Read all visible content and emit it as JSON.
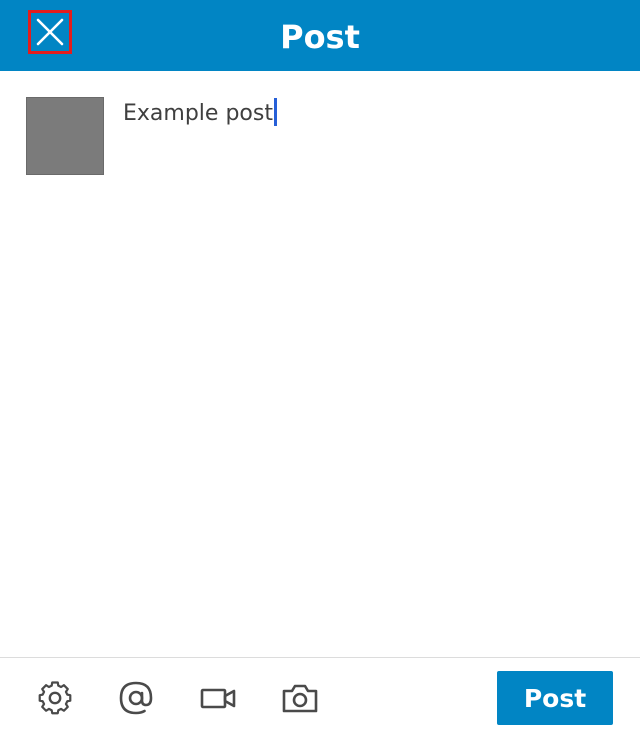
{
  "header": {
    "title": "Post",
    "close_icon": "close-icon"
  },
  "composer": {
    "text": "Example post"
  },
  "toolbar": {
    "icons": [
      "gear-icon",
      "at-icon",
      "video-camera-icon",
      "camera-icon"
    ],
    "post_label": "Post"
  },
  "colors": {
    "brand": "#0185c4",
    "highlight": "#e31d1d",
    "caret": "#2760d8",
    "avatar": "#7b7b7b"
  }
}
